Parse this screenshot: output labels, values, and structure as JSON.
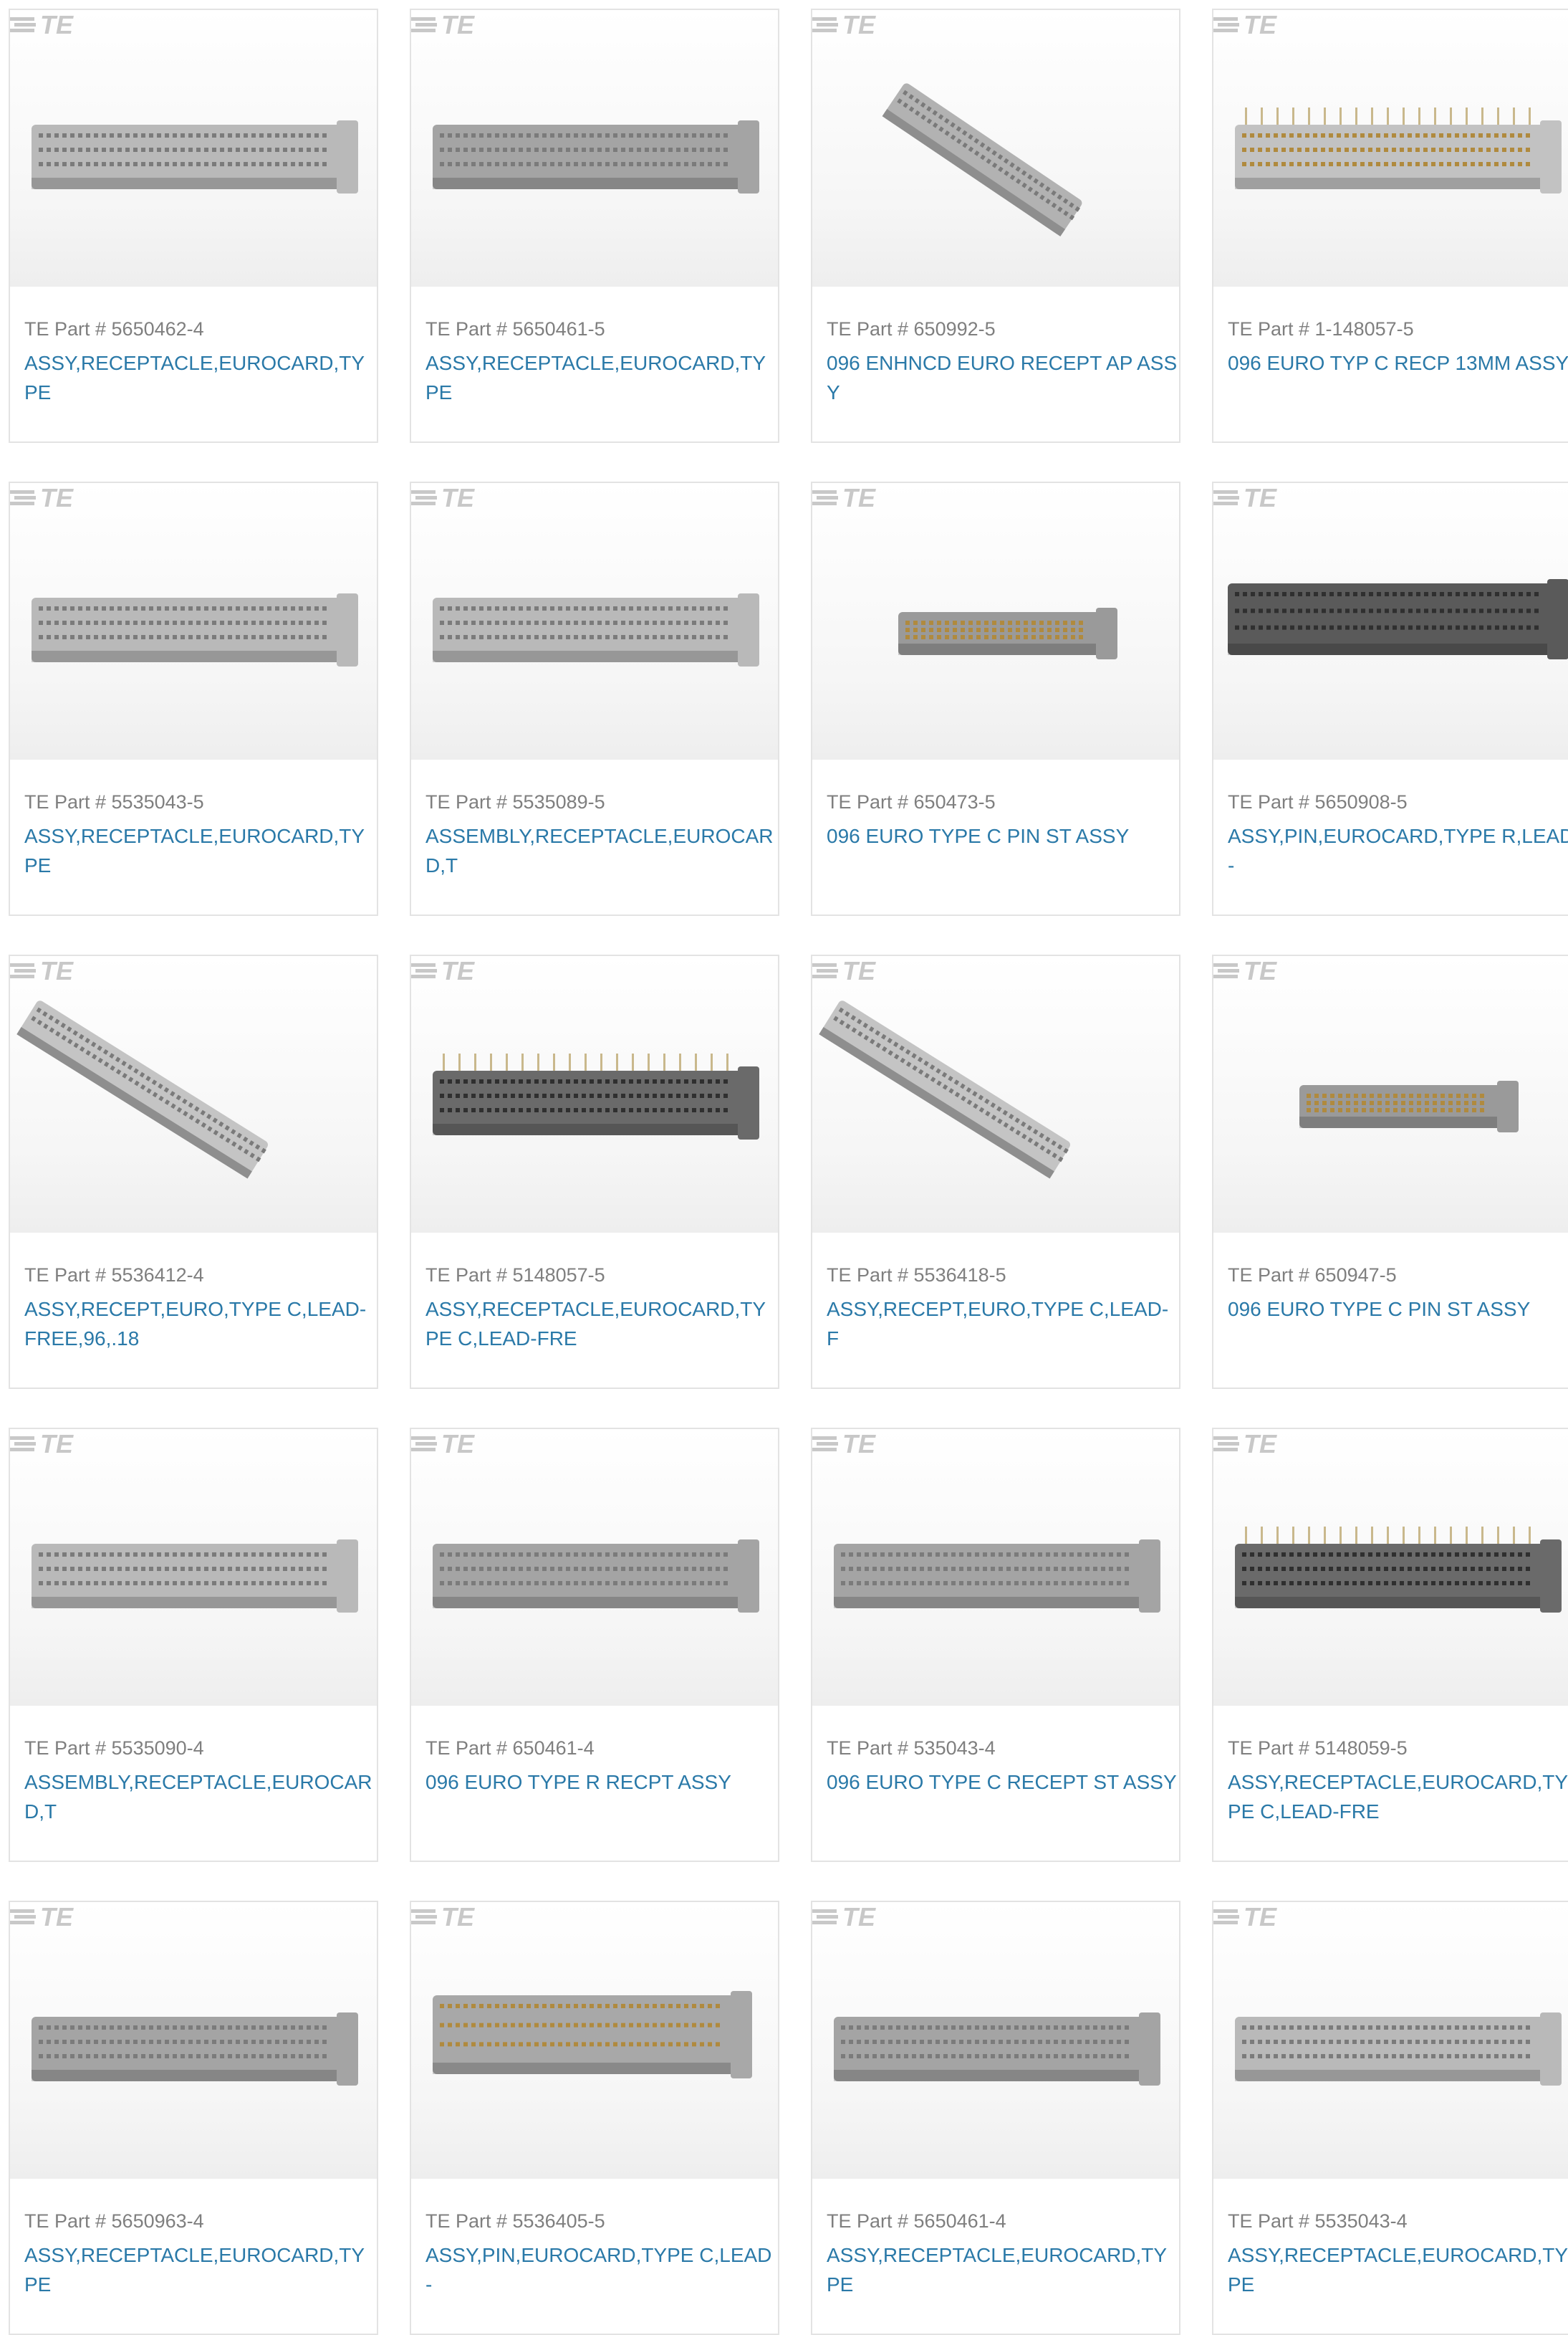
{
  "label_prefix": "TE Part #",
  "brand": "TE",
  "colors": {
    "link": "#2a79a8",
    "muted": "#7f7f7f",
    "border": "#e3e3e3"
  },
  "products": [
    {
      "part": "5650462-4",
      "title": "ASSY,RECEPTACLE,EUROCARD,TYPE",
      "image": "light-gray-connector"
    },
    {
      "part": "5650461-5",
      "title": "ASSY,RECEPTACLE,EUROCARD,TYPE",
      "image": "gray-connector"
    },
    {
      "part": "650992-5",
      "title": "096 ENHNCD EURO RECEPT AP ASSY",
      "image": "angled-gray-connector"
    },
    {
      "part": "1-148057-5",
      "title": "096 EURO TYP C RECP 13MM ASSY",
      "image": "light-gray-connector-gold-pins"
    },
    {
      "part": "5535043-5",
      "title": "ASSY,RECEPTACLE,EUROCARD,TYPE",
      "image": "light-gray-connector"
    },
    {
      "part": "5535089-5",
      "title": "ASSEMBLY,RECEPTACLE,EUROCARD,T",
      "image": "light-gray-connector"
    },
    {
      "part": "650473-5",
      "title": "096 EURO TYPE C PIN ST ASSY",
      "image": "pin-header-gold"
    },
    {
      "part": "5650908-5",
      "title": "ASSY,PIN,EUROCARD,TYPE R,LEAD-",
      "image": "dark-pin-connector"
    },
    {
      "part": "5536412-4",
      "title": "ASSY,RECEPT,EURO,TYPE C,LEAD-FREE,96,.18",
      "image": "diagonal-connector"
    },
    {
      "part": "5148057-5",
      "title": "ASSY,RECEPTACLE,EUROCARD,TYPE C,LEAD-FRE",
      "image": "dark-connector-pins"
    },
    {
      "part": "5536418-5",
      "title": "ASSY,RECEPT,EURO,TYPE C,LEAD-F",
      "image": "diagonal-connector"
    },
    {
      "part": "650947-5",
      "title": "096 EURO TYPE C PIN ST ASSY",
      "image": "pin-header-gold"
    },
    {
      "part": "5535090-4",
      "title": "ASSEMBLY,RECEPTACLE,EUROCARD,T",
      "image": "light-gray-connector"
    },
    {
      "part": "650461-4",
      "title": "096 EURO TYPE R RECPT ASSY",
      "image": "gray-connector"
    },
    {
      "part": "535043-4",
      "title": "096 EURO TYPE C RECEPT ST ASSY",
      "image": "gray-connector"
    },
    {
      "part": "5148059-5",
      "title": "ASSY,RECEPTACLE,EUROCARD,TYPE C,LEAD-FRE",
      "image": "dark-connector-pins"
    },
    {
      "part": "5650963-4",
      "title": "ASSY,RECEPTACLE,EUROCARD,TYPE",
      "image": "gray-connector"
    },
    {
      "part": "5536405-5",
      "title": "ASSY,PIN,EUROCARD,TYPE C,LEAD-",
      "image": "pin-header-gold-large"
    },
    {
      "part": "5650461-4",
      "title": "ASSY,RECEPTACLE,EUROCARD,TYPE",
      "image": "gray-connector"
    },
    {
      "part": "5535043-4",
      "title": "ASSY,RECEPTACLE,EUROCARD,TYPE",
      "image": "light-gray-connector"
    }
  ]
}
